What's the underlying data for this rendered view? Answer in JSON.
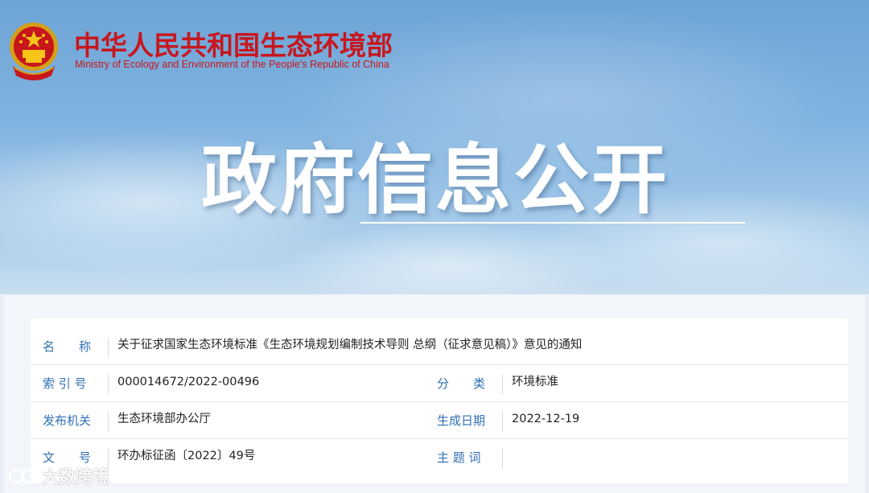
{
  "header": {
    "ministry_cn": "中华人民共和国生态环境部",
    "ministry_en": "Ministry of Ecology and Environment of the People's Republic of China",
    "banner_title": "政府信息公开"
  },
  "info": {
    "name_label": "名　　称",
    "name_value": "关于征求国家生态环境标准《生态环境规划编制技术导则 总纲（征求意见稿）》意见的通知",
    "index_label": "索 引 号",
    "index_value": "000014672/2022-00496",
    "category_label": "分　　类",
    "category_value": "环境标准",
    "publisher_label": "发布机关",
    "publisher_value": "生态环境部办公厅",
    "date_label": "生成日期",
    "date_value": "2022-12-19",
    "docno_label": "文　　号",
    "docno_value": "环办标征函〔2022〕49号",
    "keywords_label": "主 题 词",
    "keywords_value": ""
  },
  "watermark": {
    "text": "大数跨境"
  },
  "colors": {
    "brand_red": "#c8161d",
    "label_blue": "#2f6fb4"
  }
}
